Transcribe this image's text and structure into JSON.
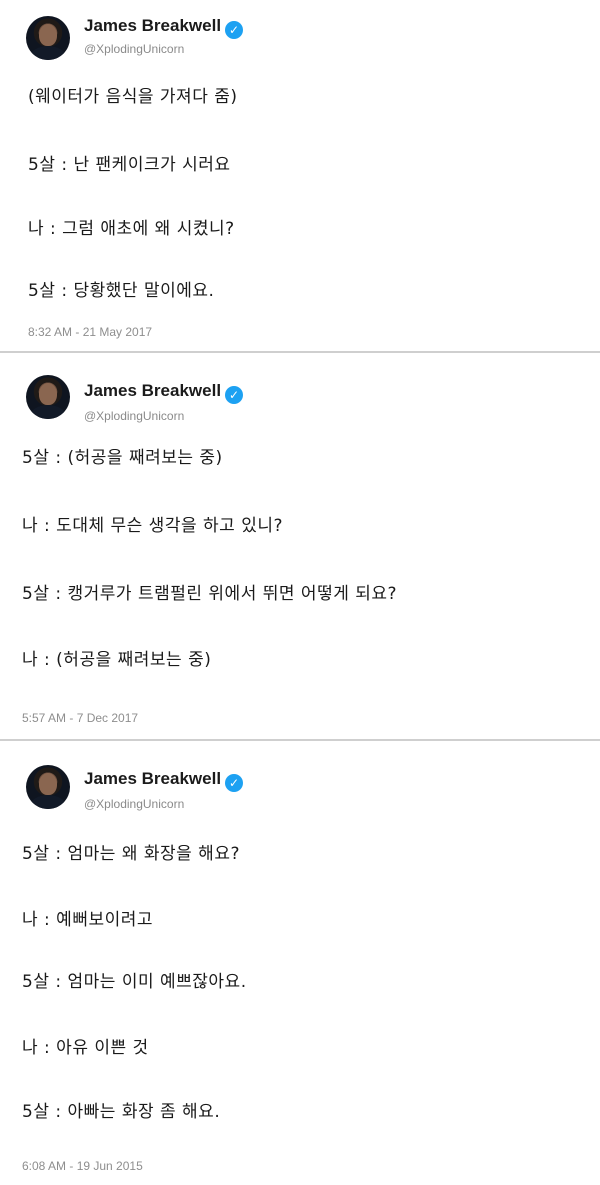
{
  "tweets": [
    {
      "author": "James Breakwell",
      "handle": "@XplodingUnicorn",
      "verified_icon": "verified-check-icon",
      "lines": [
        "(웨이터가 음식을 가져다 줌)",
        "5살 : 난 팬케이크가 시러요",
        "나 : 그럼 애초에 왜 시켰니?",
        "5살 : 당황했단 말이에요."
      ],
      "timestamp": "8:32 AM - 21 May 2017"
    },
    {
      "author": "James Breakwell",
      "handle": "@XplodingUnicorn",
      "verified_icon": "verified-check-icon",
      "lines": [
        "5살 : (허공을 째려보는 중)",
        "나 : 도대체 무슨 생각을 하고 있니?",
        "5살 : 캥거루가 트램펄린 위에서 뛰면 어떻게 되요?",
        "나 : (허공을 째려보는 중)"
      ],
      "timestamp": "5:57 AM - 7 Dec 2017"
    },
    {
      "author": "James Breakwell",
      "handle": "@XplodingUnicorn",
      "verified_icon": "verified-check-icon",
      "lines": [
        "5살 : 엄마는 왜 화장을 해요?",
        "나 : 예뻐보이려고",
        "5살 : 엄마는 이미 예쁘잖아요.",
        "나 : 아유 이쁜 것",
        "5살 : 아빠는 화장 좀 해요."
      ],
      "timestamp": "6:08 AM - 19 Jun 2015"
    }
  ],
  "colors": {
    "verified": "#1da1f2",
    "divider": "#cfcfcf",
    "muted": "#8e8e8e"
  }
}
